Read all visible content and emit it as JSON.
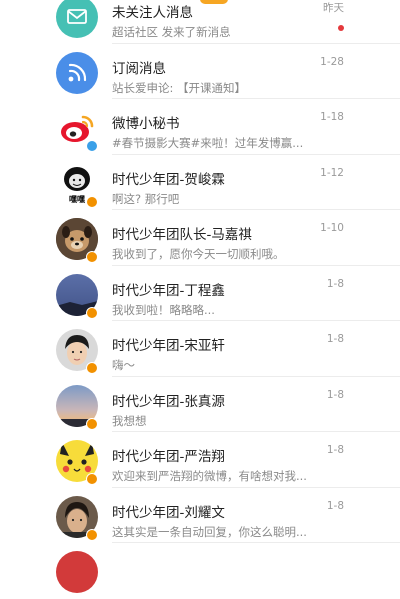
{
  "messages": [
    {
      "name": "未关注人消息",
      "preview": "超话社区 发来了新消息",
      "time": "昨天",
      "unread": true,
      "avatar": "mail-icon"
    },
    {
      "name": "订阅消息",
      "preview": "站长爱申论: 【开课通知】",
      "time": "1-28",
      "avatar": "rss-icon"
    },
    {
      "name": "微博小秘书",
      "preview": "#春节摄影大赛#来啦！过年发博赢...",
      "time": "1-18",
      "avatar": "weibo-logo"
    },
    {
      "name": "时代少年团-贺峻霖",
      "preview": "啊这? 那行吧",
      "time": "1-12",
      "avatar": "meme-avatar",
      "avatar_text": "嘿嘿"
    },
    {
      "name": "时代少年团队长-马嘉祺",
      "preview": "我收到了，愿你今天一切顺利哦。",
      "time": "1-10",
      "avatar": "dog-avatar"
    },
    {
      "name": "时代少年团-丁程鑫",
      "preview": "我收到啦！略略略...",
      "time": "1-8",
      "avatar": "sky-avatar"
    },
    {
      "name": "时代少年团-宋亚轩",
      "preview": "嗨～",
      "time": "1-8",
      "avatar": "person-avatar"
    },
    {
      "name": "时代少年团-张真源",
      "preview": "我想想",
      "time": "1-8",
      "avatar": "sunset-avatar"
    },
    {
      "name": "时代少年团-严浩翔",
      "preview": "欢迎来到严浩翔的微博，有啥想对我...",
      "time": "1-8",
      "avatar": "pikachu-avatar"
    },
    {
      "name": "时代少年团-刘耀文",
      "preview": "这其实是一条自动回复，你这么聪明...",
      "time": "1-8",
      "avatar": "portrait-avatar"
    }
  ]
}
